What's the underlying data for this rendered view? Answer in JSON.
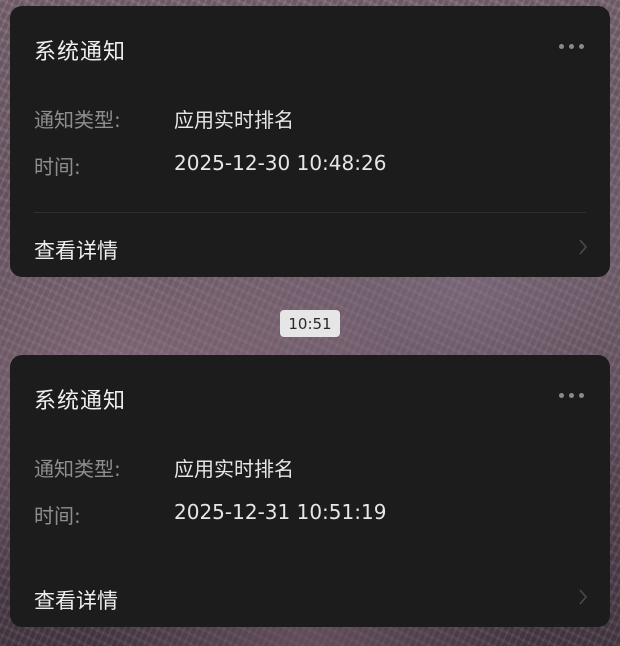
{
  "notifications": [
    {
      "title": "系统通知",
      "type_label": "通知类型:",
      "type_value": "应用实时排名",
      "time_label": "时间:",
      "time_value": "2025-12-30 10:48:26",
      "details_label": "查看详情"
    },
    {
      "title": "系统通知",
      "type_label": "通知类型:",
      "type_value": "应用实时排名",
      "time_label": "时间:",
      "time_value": "2025-12-31 10:51:19",
      "details_label": "查看详情"
    }
  ],
  "time_separator": "10:51",
  "icons": {
    "more": "more-icon",
    "chevron": "chevron-right-icon"
  }
}
